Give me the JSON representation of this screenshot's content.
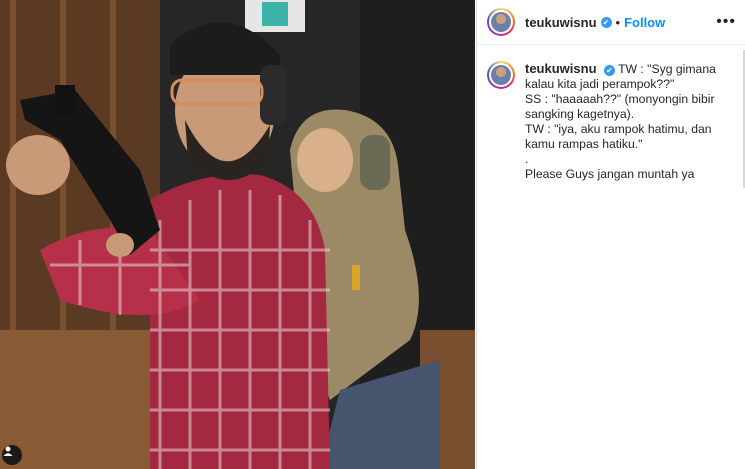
{
  "post": {
    "username": "teukuwisnu",
    "verified_label": "✔",
    "separator": "•",
    "follow_label": "Follow",
    "more_label": "•••"
  },
  "caption": {
    "username": "teukuwisnu",
    "lines": [
      "TW : \"Syg gimana",
      "kalau kita jadi perampok??\"",
      "SS : \"haaaaah??\" (monyongin bibir",
      "sangking kagetnya).",
      "TW : \"iya, aku rampok hatimu, dan",
      "kamu rampas hatiku.\"",
      ".",
      "Please Guys jangan muntah ya"
    ]
  },
  "colors": {
    "link": "#0095f6",
    "verified": "#3897f0",
    "text": "#262626"
  },
  "icons": {
    "user_tag": "person-icon",
    "more": "more-options-icon",
    "verified": "verified-badge-icon"
  }
}
